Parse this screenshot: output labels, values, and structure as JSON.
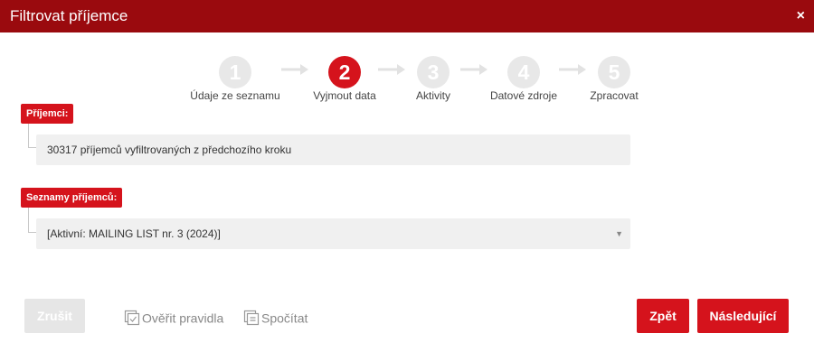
{
  "dialog": {
    "title": "Filtrovat příjemce",
    "close_glyph": "×"
  },
  "wizard": {
    "active_step": 2,
    "steps": [
      {
        "number": "1",
        "label": "Údaje ze seznamu"
      },
      {
        "number": "2",
        "label": "Vyjmout data"
      },
      {
        "number": "3",
        "label": "Aktivity"
      },
      {
        "number": "4",
        "label": "Datové zdroje"
      },
      {
        "number": "5",
        "label": "Zpracovat"
      }
    ]
  },
  "recipients": {
    "tag": "Příjemci:",
    "value": "30317 příjemců vyfiltrovaných z předchozího kroku"
  },
  "lists": {
    "tag": "Seznamy příjemců:",
    "selected": "[Aktivní: MAILING LIST nr. 3 (2024)]",
    "caret": "▼"
  },
  "footer": {
    "cancel": "Zrušit",
    "verify_rules": "Ověřit pravidla",
    "count": "Spočítat",
    "back": "Zpět",
    "next": "Následující"
  },
  "colors": {
    "titlebar": "#9a0a0e",
    "accent": "#d5131c",
    "inactive_step": "#e8e8e8"
  },
  "icons": {
    "arrow": "arrow-right-icon",
    "verify": "document-check-icon",
    "count": "document-calculate-icon",
    "close": "close-icon"
  }
}
